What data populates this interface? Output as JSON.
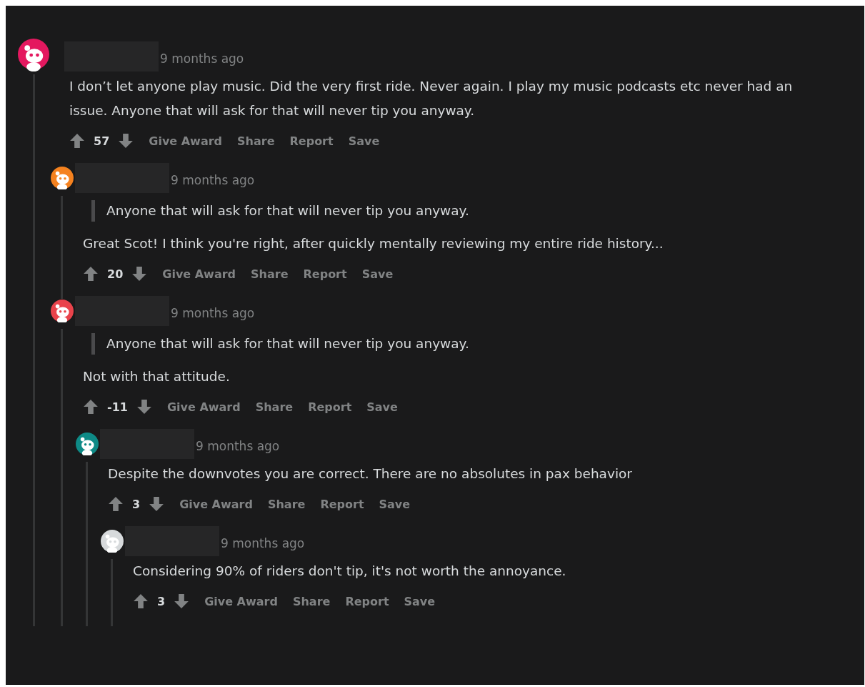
{
  "comments": [
    {
      "color": "#e4185f",
      "time": "9 months ago",
      "body": "I don’t let anyone play music. Did the very first ride. Never again. I play my music podcasts etc never had an issue. Anyone that will ask for that will never tip you anyway.",
      "score": "57",
      "actions": [
        "Give Award",
        "Share",
        "Report",
        "Save"
      ],
      "children": [
        {
          "color": "#f5821f",
          "time": "9 months ago",
          "quote": "Anyone that will ask for that will never tip you anyway.",
          "body": "Great Scot! I think you're right, after quickly mentally reviewing my entire ride history...",
          "score": "20",
          "actions": [
            "Give Award",
            "Share",
            "Report",
            "Save"
          ]
        },
        {
          "color": "#e9434b",
          "time": "9 months ago",
          "quote": "Anyone that will ask for that will never tip you anyway.",
          "body": "Not with that attitude.",
          "score": "-11",
          "actions": [
            "Give Award",
            "Share",
            "Report",
            "Save"
          ],
          "children": [
            {
              "color": "#0e8a86",
              "time": "9 months ago",
              "body": "Despite the downvotes you are correct. There are no absolutes in pax behavior",
              "score": "3",
              "actions": [
                "Give Award",
                "Share",
                "Report",
                "Save"
              ],
              "children": [
                {
                  "color": "#d7dadc",
                  "time": "9 months ago",
                  "body": "Considering 90% of riders don't tip, it's not worth the annoyance.",
                  "score": "3",
                  "actions": [
                    "Give Award",
                    "Share",
                    "Report",
                    "Save"
                  ]
                }
              ]
            }
          ]
        }
      ]
    }
  ]
}
